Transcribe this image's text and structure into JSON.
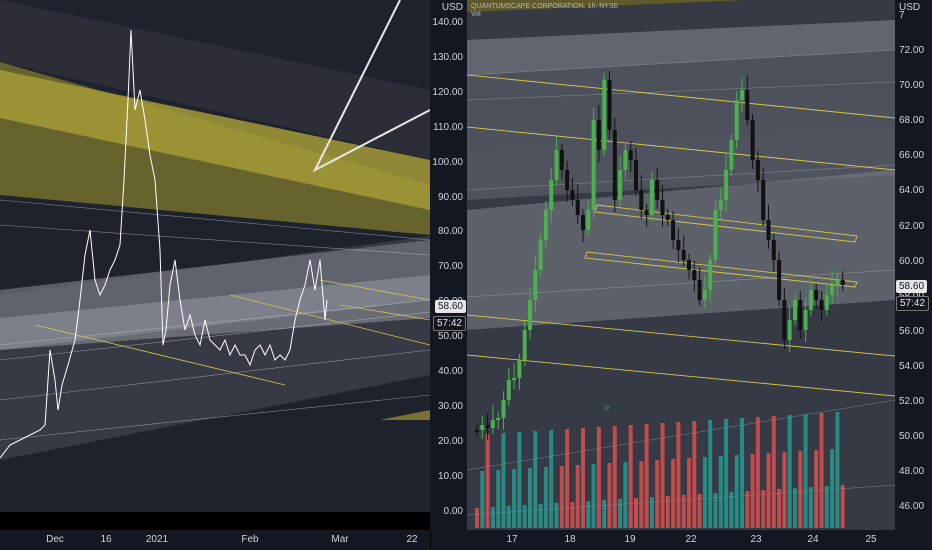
{
  "colors": {
    "background": "#131722",
    "pane": "#2a2e39",
    "up_candle": "#4caf50",
    "down_candle": "#111111",
    "up_volume": "#26a69a",
    "down_volume": "#ef5350",
    "channel_gold": "#8a8032",
    "line_yellow": "#d4c84a",
    "price_line": "#ffffff"
  },
  "left_chart": {
    "price_axis": {
      "unit": "USD",
      "ticks": [
        "140.00",
        "130.00",
        "120.00",
        "110.00",
        "100.00",
        "90.00",
        "80.00",
        "70.00",
        "60.00",
        "50.00",
        "40.00",
        "30.00",
        "20.00",
        "10.00",
        "0.00"
      ]
    },
    "last_price": "58.60",
    "countdown": "57:42",
    "time_labels": [
      "Dec",
      "16",
      "2021",
      "Feb",
      "Mar",
      "22"
    ]
  },
  "right_chart": {
    "symbol": "QUANTUMSCAPE CORPORATION, 1h, NYSE",
    "indicator": "Vol",
    "price_axis": {
      "unit": "USD",
      "top_partial": "7",
      "ticks": [
        "72.00",
        "70.00",
        "68.00",
        "66.00",
        "64.00",
        "62.00",
        "60.00",
        "58.00",
        "56.00",
        "54.00",
        "52.00",
        "50.00",
        "48.00",
        "46.00"
      ]
    },
    "last_price": "58.60",
    "countdown": "57:42",
    "time_labels": [
      "17",
      "18",
      "19",
      "22",
      "23",
      "24",
      "25"
    ]
  }
}
